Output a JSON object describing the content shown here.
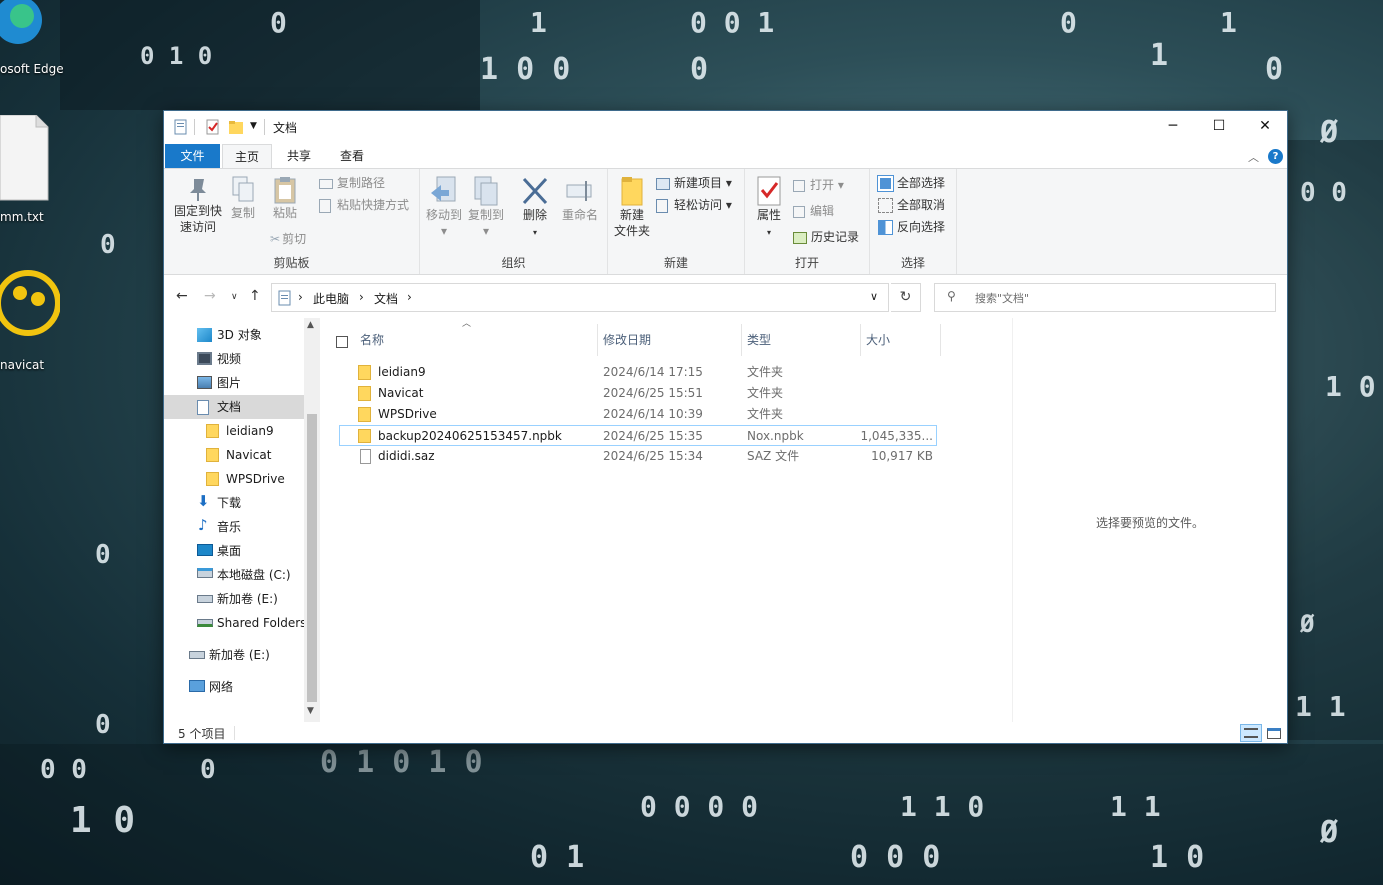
{
  "desktop": {
    "icons": [
      {
        "label": "osoft Edge",
        "icon": "edge-icon"
      },
      {
        "label": "mm.txt",
        "icon": "text-file-icon"
      },
      {
        "label": "navicat",
        "icon": "navicat-icon"
      }
    ]
  },
  "window": {
    "title": "文档",
    "controls": {
      "minimize": "─",
      "maximize": "☐",
      "close": "✕"
    },
    "tabs": [
      {
        "label": "文件",
        "active": false,
        "file": true
      },
      {
        "label": "主页",
        "active": true
      },
      {
        "label": "共享",
        "active": false
      },
      {
        "label": "查看",
        "active": false
      }
    ],
    "help": "?"
  },
  "ribbon": {
    "clipboard": {
      "label": "剪贴板",
      "pin": "固定到快\n速访问",
      "copy": "复制",
      "paste": "粘贴",
      "copy_path": "复制路径",
      "paste_shortcut": "粘贴快捷方式",
      "cut": "剪切"
    },
    "organize": {
      "label": "组织",
      "move_to": "移动到",
      "copy_to": "复制到",
      "delete": "删除",
      "rename": "重命名"
    },
    "new": {
      "label": "新建",
      "new_folder": "新建\n文件夹",
      "new_item": "新建项目",
      "easy_access": "轻松访问"
    },
    "open": {
      "label": "打开",
      "properties": "属性",
      "open": "打开",
      "edit": "编辑",
      "history": "历史记录"
    },
    "select": {
      "label": "选择",
      "select_all": "全部选择",
      "select_none": "全部取消",
      "invert": "反向选择"
    }
  },
  "address": {
    "crumbs": [
      "此电脑",
      "文档"
    ],
    "search_placeholder": "搜索\"文档\""
  },
  "nav": {
    "items": [
      {
        "label": "3D 对象",
        "icon": "3d-objects-icon",
        "indent": 0,
        "selected": false
      },
      {
        "label": "视频",
        "icon": "video-icon",
        "indent": 0,
        "selected": false
      },
      {
        "label": "图片",
        "icon": "pictures-icon",
        "indent": 0,
        "selected": false
      },
      {
        "label": "文档",
        "icon": "documents-icon",
        "indent": 0,
        "selected": true
      },
      {
        "label": "leidian9",
        "icon": "folder-icon",
        "indent": 1,
        "selected": false
      },
      {
        "label": "Navicat",
        "icon": "folder-icon",
        "indent": 1,
        "selected": false
      },
      {
        "label": "WPSDrive",
        "icon": "folder-icon",
        "indent": 1,
        "selected": false
      },
      {
        "label": "下载",
        "icon": "downloads-icon",
        "indent": 0,
        "selected": false
      },
      {
        "label": "音乐",
        "icon": "music-icon",
        "indent": 0,
        "selected": false
      },
      {
        "label": "桌面",
        "icon": "desktop-icon",
        "indent": 0,
        "selected": false
      },
      {
        "label": "本地磁盘 (C:)",
        "icon": "drive-c-icon",
        "indent": 0,
        "selected": false
      },
      {
        "label": "新加卷 (E:)",
        "icon": "drive-icon",
        "indent": 0,
        "selected": false
      },
      {
        "label": "Shared Folders",
        "icon": "network-drive-icon",
        "indent": 0,
        "selected": false
      },
      {
        "label": "新加卷 (E:)",
        "icon": "drive-icon",
        "indent": -1,
        "selected": false
      },
      {
        "label": "网络",
        "icon": "network-icon",
        "indent": -1,
        "selected": false
      }
    ]
  },
  "files": {
    "columns": {
      "name": "名称",
      "modified": "修改日期",
      "type": "类型",
      "size": "大小"
    },
    "rows": [
      {
        "name": "leidian9",
        "modified": "2024/6/14 17:15",
        "type": "文件夹",
        "size": "",
        "icon": "folder-icon"
      },
      {
        "name": "Navicat",
        "modified": "2024/6/25 15:51",
        "type": "文件夹",
        "size": "",
        "icon": "folder-icon"
      },
      {
        "name": "WPSDrive",
        "modified": "2024/6/14 10:39",
        "type": "文件夹",
        "size": "",
        "icon": "folder-icon"
      },
      {
        "name": "backup20240625153457.npbk",
        "modified": "2024/6/25 15:35",
        "type": "Nox.npbk",
        "size": "1,045,335...",
        "icon": "npbk-file-icon"
      },
      {
        "name": "dididi.saz",
        "modified": "2024/6/25 15:34",
        "type": "SAZ 文件",
        "size": "10,917 KB",
        "icon": "file-icon"
      }
    ]
  },
  "preview": {
    "text": "选择要预览的文件。"
  },
  "status": {
    "count": "5 个项目"
  },
  "colors": {
    "accent": "#1979ca",
    "selection": "#cce8ff",
    "folder": "#ffd75e"
  }
}
